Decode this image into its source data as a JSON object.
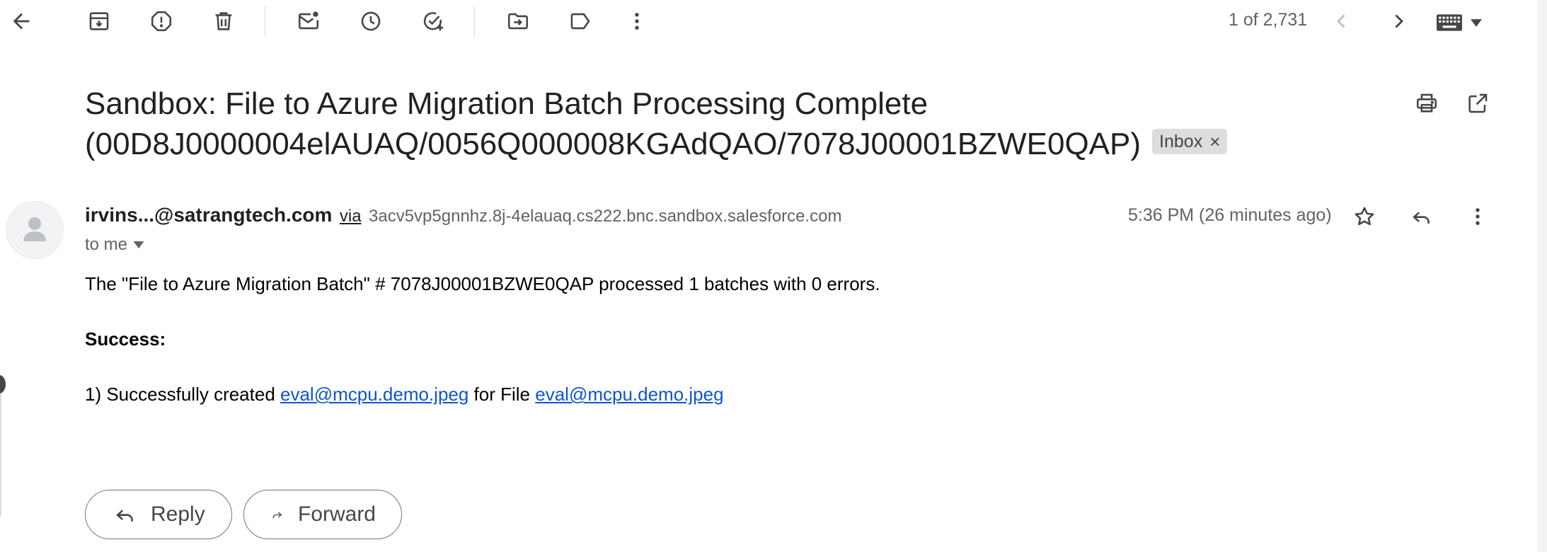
{
  "toolbar": {
    "back_label": "Back to Inbox",
    "counter": "1 of 2,731"
  },
  "email": {
    "subject_line1": "Sandbox: File to Azure Migration Batch Processing Complete",
    "subject_line2": "(00D8J0000004elAUAQ/0056Q000008KGAdQAO/7078J00001BZWE0QAP)",
    "label_chip": "Inbox",
    "label_chip_close": "×",
    "sender_name": "irvins...@satrangtech.com",
    "via": "via",
    "via_domain": "3acv5vp5gnnhz.8j-4elauaq.cs222.bnc.sandbox.salesforce.com",
    "recipient": "to me",
    "timestamp": "5:36 PM (26 minutes ago)",
    "body": {
      "line1": "The \"File to Azure Migration Batch\" # 7078J00001BZWE0QAP processed 1 batches with 0 errors.",
      "success_heading": "Success:",
      "item_prefix": "1) Successfully created ",
      "item_link1": "eval@mcpu.demo.jpeg",
      "item_middle": " for File ",
      "item_link2": "eval@mcpu.demo.jpeg"
    }
  },
  "actions": {
    "reply": "Reply",
    "forward": "Forward"
  },
  "icons": {
    "back": "arrow-left-icon",
    "archive": "archive-icon",
    "spam": "report-spam-icon",
    "delete": "trash-icon",
    "unread": "mark-unread-icon",
    "snooze": "clock-icon",
    "task": "add-task-icon",
    "move": "move-to-folder-icon",
    "label": "label-icon",
    "more": "more-vert-icon",
    "prev": "chevron-left-icon",
    "next": "chevron-right-icon",
    "input_tools": "keyboard-icon",
    "print": "print-icon",
    "open_new_window": "open-in-new-icon",
    "star": "star-icon",
    "reply": "reply-icon",
    "forward": "forward-icon"
  },
  "colors": {
    "link": "#1155cc",
    "icon": "#444746",
    "chip_bg": "#dddddd"
  }
}
